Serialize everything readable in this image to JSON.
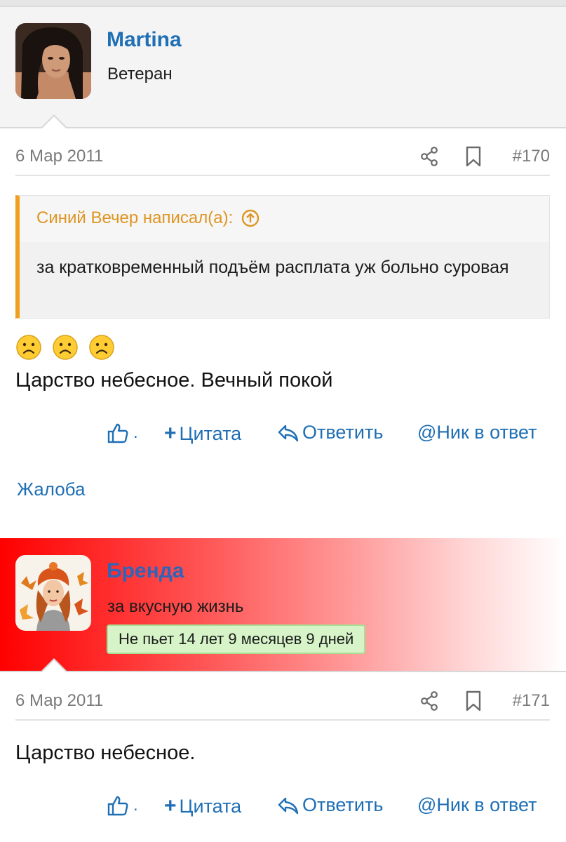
{
  "posts": [
    {
      "username": "Martina",
      "user_title": "Ветеран",
      "badge": "",
      "date": "6 Мар 2011",
      "post_number": "#170",
      "quote": {
        "author_line": "Синий Вечер написал(а):",
        "text": "за кратковременный подъём расплата уж больно суровая"
      },
      "emojis": [
        "frowning-face",
        "frowning-face",
        "frowning-face"
      ],
      "text": "Царство небесное. Вечный покой",
      "actions": {
        "like_count": ".",
        "quote_label": "Цитата",
        "reply_label": "Ответить",
        "nick_label": "@Ник в ответ",
        "report_label": "Жалоба"
      }
    },
    {
      "username": "Бренда",
      "user_title": "за вкусную жизнь",
      "badge": "Не пьет 14 лет 9 месяцев 9 дней",
      "date": "6 Мар 2011",
      "post_number": "#171",
      "text": "Царство небесное.",
      "actions": {
        "like_count": ".",
        "quote_label": "Цитата",
        "reply_label": "Ответить",
        "nick_label": "@Ник в ответ"
      }
    }
  ],
  "colors": {
    "link": "#1f6fb5",
    "quote_accent": "#f0a020",
    "badge_bg": "#d6f4c8",
    "header_gradient_start": "#ff0000"
  }
}
